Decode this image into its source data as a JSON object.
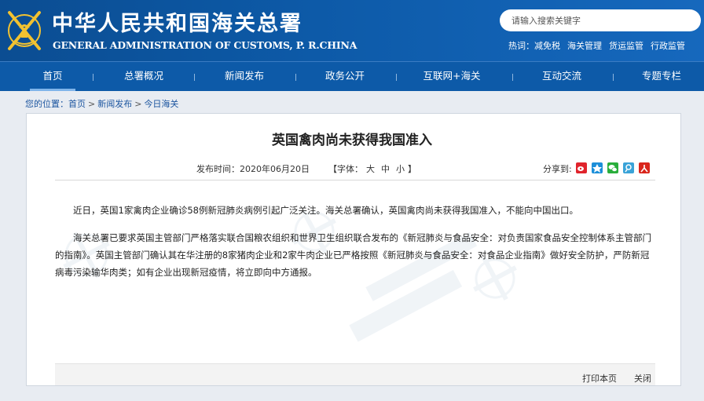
{
  "header": {
    "title": "中华人民共和国海关总署",
    "subtitle": "GENERAL ADMINISTRATION OF CUSTOMS, P. R.CHINA",
    "search_placeholder": "请输入搜索关键字",
    "hot_label": "热词：",
    "hot_words": [
      "减免税",
      "海关管理",
      "货运监管",
      "行政监管"
    ]
  },
  "nav": {
    "items": [
      "首页",
      "总署概况",
      "新闻发布",
      "政务公开",
      "互联网+海关",
      "互动交流",
      "专题专栏"
    ],
    "active": "首页"
  },
  "breadcrumb": {
    "prefix": "您的位置：",
    "items": [
      "首页",
      "新闻发布",
      "今日海关"
    ],
    "separator": ">"
  },
  "article": {
    "title": "英国禽肉尚未获得我国准入",
    "publish_time": "发布时间：2020年06月20日",
    "font_label": "【字体：",
    "font_sizes": [
      "大",
      "中",
      "小"
    ],
    "font_close": "】",
    "share_label": "分享到:",
    "share_icons": [
      "sina-weibo-icon",
      "qq-zone-icon",
      "wechat-icon",
      "tencent-weibo-icon",
      "renren-icon"
    ],
    "paragraphs": [
      "近日，英国1家禽肉企业确诊58例新冠肺炎病例引起广泛关注。海关总署确认，英国禽肉尚未获得我国准入，不能向中国出口。",
      "海关总署已要求英国主管部门严格落实联合国粮农组织和世界卫生组织联合发布的《新冠肺炎与食品安全：对负责国家食品安全控制体系主管部门的指南》。英国主管部门确认其在华注册的8家猪肉企业和2家牛肉企业已严格按照《新冠肺炎与食品安全：对食品企业指南》做好安全防护，严防新冠病毒污染输华肉类；如有企业出现新冠疫情，将立即向中方通报。"
    ],
    "print_label": "打印本页",
    "close_label": "关闭"
  },
  "colors": {
    "header_bg": "#0d5aa8",
    "share_sina": "#e0242c",
    "share_qzone": "#1c8fd9",
    "share_wechat": "#2aae3c",
    "share_tqq": "#3aa3d8",
    "share_renren": "#d9261c"
  }
}
